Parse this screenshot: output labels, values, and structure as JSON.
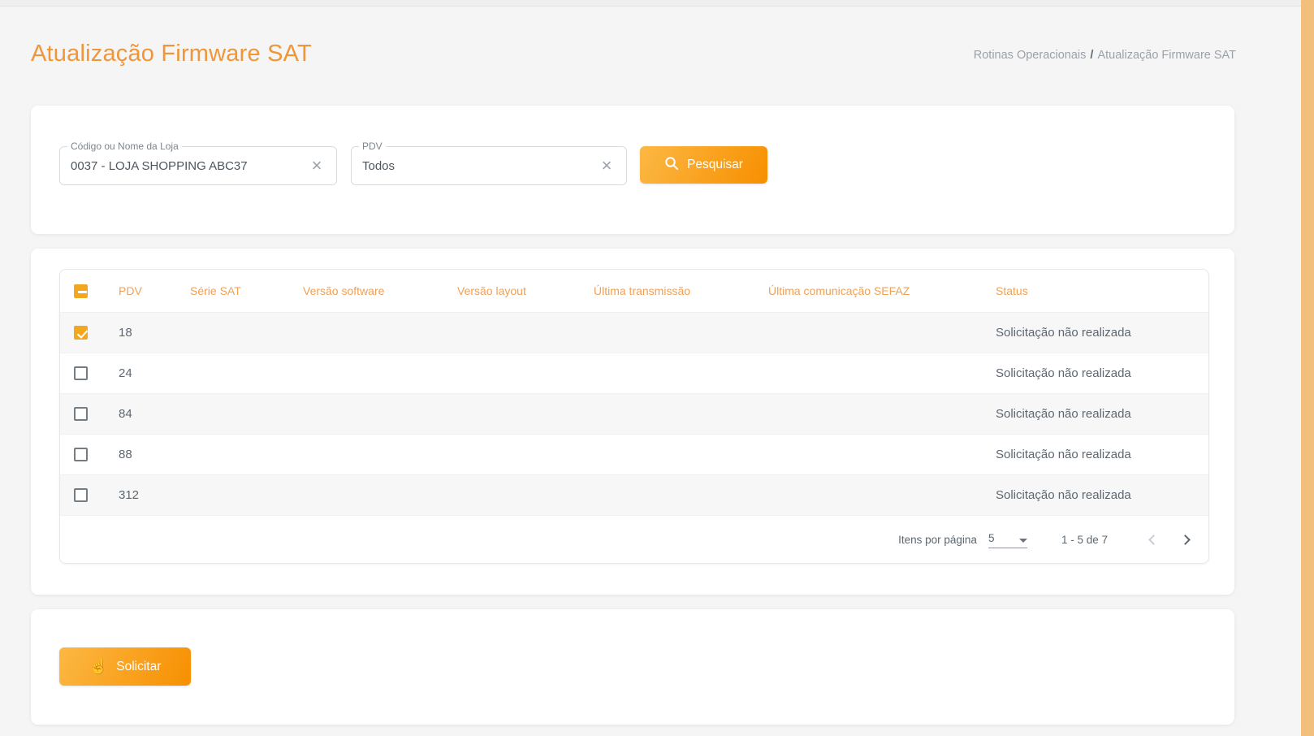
{
  "header": {
    "title": "Atualização Firmware SAT",
    "breadcrumb": {
      "parent": "Rotinas Operacionais",
      "separator": "/",
      "current": "Atualização Firmware SAT"
    }
  },
  "filters": {
    "store_field": {
      "label": "Código ou Nome da Loja",
      "value": "0037 - LOJA SHOPPING ABC37",
      "clear_icon": "×"
    },
    "pdv_field": {
      "label": "PDV",
      "value": "Todos",
      "clear_icon": "×"
    },
    "search_button_label": "Pesquisar"
  },
  "table": {
    "select_all_indeterminate": true,
    "columns": {
      "pdv": "PDV",
      "serie_sat": "Série SAT",
      "versao_software": "Versão software",
      "versao_layout": "Versão layout",
      "ultima_transmissao": "Última transmissão",
      "ultima_comunicacao_sefaz": "Última comunicação SEFAZ",
      "status": "Status"
    },
    "rows": [
      {
        "checked": true,
        "pdv": "18",
        "serie_sat": "",
        "versao_software": "",
        "versao_layout": "",
        "ultima_transmissao": "",
        "ultima_comunicacao_sefaz": "",
        "status": "Solicitação não realizada"
      },
      {
        "checked": false,
        "pdv": "24",
        "serie_sat": "",
        "versao_software": "",
        "versao_layout": "",
        "ultima_transmissao": "",
        "ultima_comunicacao_sefaz": "",
        "status": "Solicitação não realizada"
      },
      {
        "checked": false,
        "pdv": "84",
        "serie_sat": "",
        "versao_software": "",
        "versao_layout": "",
        "ultima_transmissao": "",
        "ultima_comunicacao_sefaz": "",
        "status": "Solicitação não realizada"
      },
      {
        "checked": false,
        "pdv": "88",
        "serie_sat": "",
        "versao_software": "",
        "versao_layout": "",
        "ultima_transmissao": "",
        "ultima_comunicacao_sefaz": "",
        "status": "Solicitação não realizada"
      },
      {
        "checked": false,
        "pdv": "312",
        "serie_sat": "",
        "versao_software": "",
        "versao_layout": "",
        "ultima_transmissao": "",
        "ultima_comunicacao_sefaz": "",
        "status": "Solicitação não realizada"
      }
    ],
    "pagination": {
      "items_per_page_label": "Itens por página",
      "items_per_page_value": "5",
      "range": "1 - 5 de 7"
    }
  },
  "footer": {
    "request_button_label": "Solicitar",
    "request_button_icon": "☝"
  },
  "colors": {
    "accent_orange": "#ef9638",
    "header_text_orange": "#f0a055",
    "checkbox_orange": "#f1a81f",
    "button_gradient_start": "#fcb844",
    "button_gradient_end": "#f78f00",
    "scrollbar_orange": "#f2c07c",
    "row_stripe": "#f7f7f8"
  }
}
